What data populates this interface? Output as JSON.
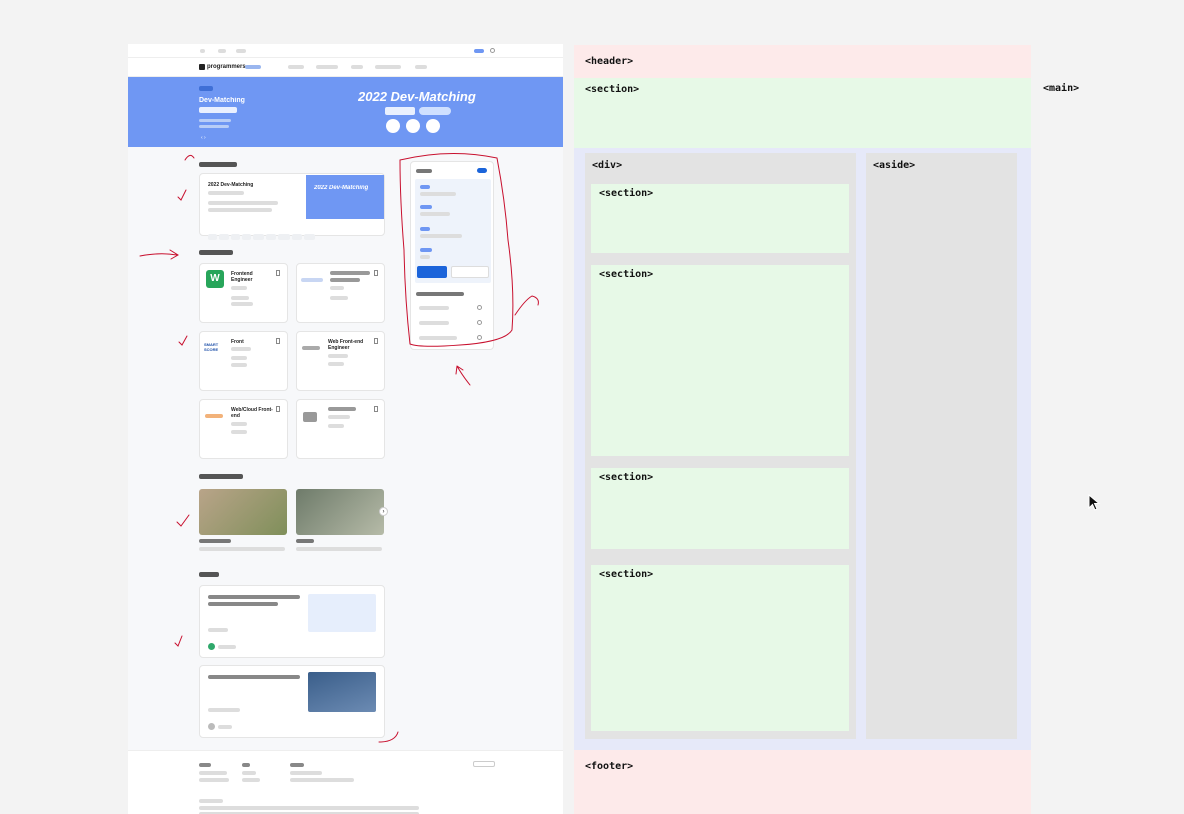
{
  "page": {
    "top_links": [
      "",
      "",
      ""
    ],
    "top_right": "",
    "logo_text": "programmers",
    "nav": [
      "",
      "",
      "",
      "",
      ""
    ],
    "banner": {
      "tag": "",
      "title_line1": "Dev-Matching",
      "title_line2": "",
      "big_title": "2022 Dev-Matching",
      "pager": "‹  ›"
    },
    "section1": {
      "title": ""
    },
    "job_card": {
      "title": "2022 Dev-Matching",
      "thumb_title": "2022 Dev-Matching"
    },
    "section2": {
      "title": ""
    },
    "job_posts": [
      {
        "title": "Frontend Engineer",
        "logo": "W"
      },
      {
        "title": "",
        "logo": ""
      },
      {
        "title": "Front",
        "logo": "SMART SCORE"
      },
      {
        "title": "Web Front-end Engineer",
        "logo": ""
      },
      {
        "title": "Web/Cloud Front-end",
        "logo": ""
      },
      {
        "title": "",
        "logo": ""
      }
    ],
    "section3": {
      "title": ""
    },
    "section4": {
      "title": ""
    },
    "sidebar": {
      "title": "",
      "name": "",
      "btn_primary": "",
      "btn_secondary": ""
    }
  },
  "wireframe": {
    "header": "<header>",
    "main": "<main>",
    "top_section": "<section>",
    "div": "<div>",
    "aside": "<aside>",
    "sections": [
      "<section>",
      "<section>",
      "<section>",
      "<section>"
    ],
    "footer": "<footer>"
  },
  "colors": {
    "header_block": "#fdeaea",
    "section_block": "#e7f9e7",
    "main_block": "#e6e9f9",
    "div_block": "#e3e3e3",
    "banner": "#6f97f3",
    "annotation": "#c8102e"
  }
}
